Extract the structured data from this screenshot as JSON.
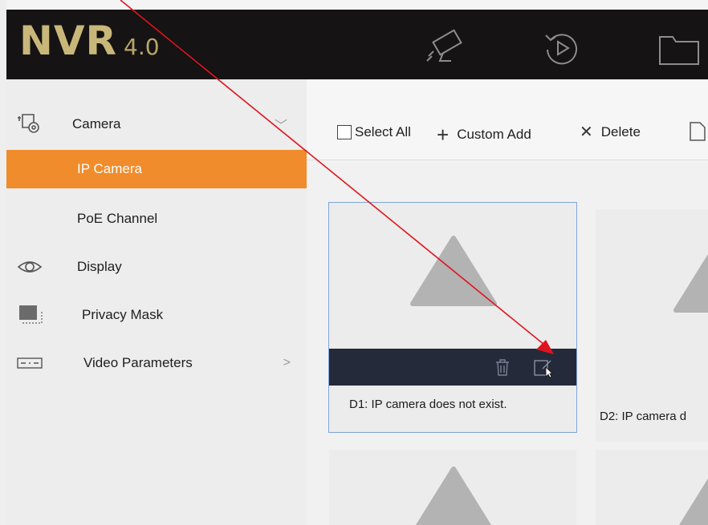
{
  "header": {
    "brand_main": "NVR",
    "brand_version": "4.0",
    "icons": [
      "camera-icon",
      "playback-icon",
      "folder-icon"
    ]
  },
  "sidebar": {
    "items": [
      {
        "label": "Camera",
        "icon": "camera-settings-icon",
        "arrow": "﹀",
        "selected": false
      },
      {
        "label": "IP Camera",
        "selected": true
      },
      {
        "label": "PoE Channel",
        "selected": false
      },
      {
        "label": "Display",
        "icon": "eye-icon",
        "selected": false
      },
      {
        "label": "Privacy Mask",
        "icon": "privacy-mask-icon",
        "selected": false
      },
      {
        "label": "Video Parameters",
        "icon": "video-parameters-icon",
        "arrow": ">",
        "selected": false
      }
    ]
  },
  "toolbar": {
    "select_all": "Select All",
    "custom_add_glyph": "+",
    "custom_add": "Custom Add",
    "delete_glyph": "✕",
    "delete": "Delete"
  },
  "cards": [
    {
      "label": "D1: IP camera does not exist."
    },
    {
      "label": "D2: IP camera d"
    }
  ],
  "colors": {
    "accent": "#f08c2c",
    "topbar": "#151313",
    "card_bar": "#252a3a",
    "annotation": "#e0141e"
  }
}
